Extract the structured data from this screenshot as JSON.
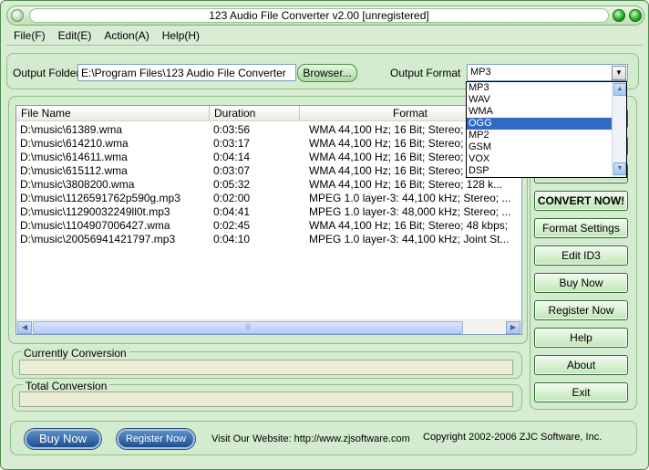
{
  "window": {
    "title": "123 Audio File Converter v2.00 [unregistered]"
  },
  "menu": [
    "File(F)",
    "Edit(E)",
    "Action(A)",
    "Help(H)"
  ],
  "output": {
    "folder_label": "Output Folder",
    "folder_value": "E:\\Program Files\\123 Audio File Converter",
    "browse_label": "Browser...",
    "format_label": "Output Format",
    "format_value": "MP3",
    "format_options": [
      "MP3",
      "WAV",
      "WMA",
      "OGG",
      "MP2",
      "GSM",
      "VOX",
      "DSP"
    ],
    "format_highlighted": "OGG"
  },
  "files": {
    "columns": [
      "File Name",
      "Duration",
      "Format"
    ],
    "rows": [
      [
        "D:\\music\\61389.wma",
        "0:03:56",
        "WMA 44,100 Hz; 16 Bit; Stereo; 4"
      ],
      [
        "D:\\music\\614210.wma",
        "0:03:17",
        "WMA 44,100 Hz; 16 Bit; Stereo; 4"
      ],
      [
        "D:\\music\\614611.wma",
        "0:04:14",
        "WMA 44,100 Hz; 16 Bit; Stereo; 4"
      ],
      [
        "D:\\music\\615112.wma",
        "0:03:07",
        "WMA 44,100 Hz; 16 Bit; Stereo; 4"
      ],
      [
        "D:\\music\\3808200.wma",
        "0:05:32",
        "WMA 44,100 Hz; 16 Bit; Stereo; 128 k..."
      ],
      [
        "D:\\music\\1126591762p590g.mp3",
        "0:02:00",
        "MPEG 1.0 layer-3: 44,100 kHz; Stereo; ..."
      ],
      [
        "D:\\music\\11290032249ll0t.mp3",
        "0:04:41",
        "MPEG 1.0 layer-3: 48,000 kHz; Stereo; ..."
      ],
      [
        "D:\\music\\1104907006427.wma",
        "0:02:45",
        "WMA 44,100 Hz; 16 Bit; Stereo; 48 kbps;"
      ],
      [
        "D:\\music\\20056941421797.mp3",
        "0:04:10",
        "MPEG 1.0 layer-3: 44,100 kHz; Joint St..."
      ]
    ]
  },
  "progress": {
    "current_label": "Currently Conversion",
    "total_label": "Total Conversion"
  },
  "side_buttons": {
    "convert": "CONVERT NOW!",
    "format_settings": "Format Settings",
    "edit_id3": "Edit ID3",
    "buy_now": "Buy Now",
    "register_now": "Register Now",
    "help": "Help",
    "about": "About",
    "exit": "Exit"
  },
  "footer": {
    "buy_now": "Buy Now",
    "register_now": "Register Now",
    "website": "Visit Our Website: http://www.zjsoftware.com",
    "copyright": "Copyright 2002-2006 ZJC Software, Inc."
  },
  "icons": {
    "scroll_left": "◀",
    "scroll_right": "▶",
    "scroll_up": "▲",
    "scroll_down": "▼",
    "grip": "|||"
  }
}
